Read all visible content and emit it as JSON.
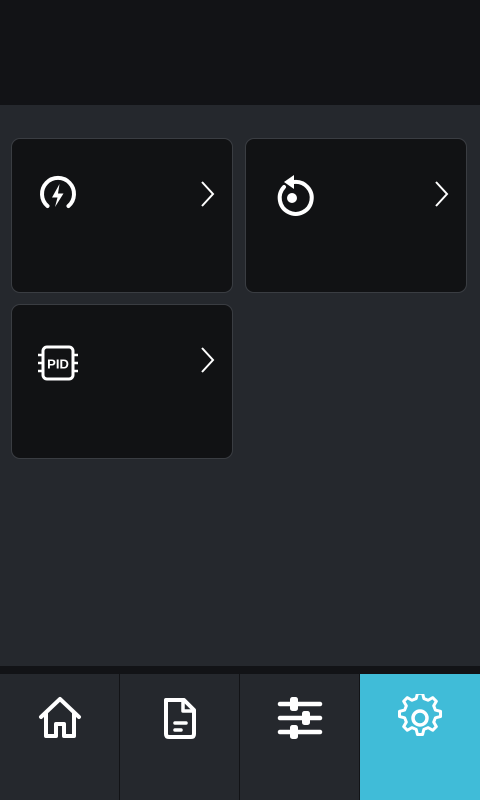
{
  "colors": {
    "background": "#25282d",
    "top_bar": "#121316",
    "card": "#111214",
    "card_border": "#3a3d42",
    "active_tab": "#40bcd8",
    "icon": "#ffffff"
  },
  "cards": [
    {
      "icon": "power-bolt-icon",
      "label": ""
    },
    {
      "icon": "restart-icon",
      "label": ""
    },
    {
      "icon": "pid-chip-icon",
      "label": ""
    }
  ],
  "nav": {
    "tabs": [
      {
        "icon": "home-icon",
        "active": false
      },
      {
        "icon": "document-icon",
        "active": false
      },
      {
        "icon": "sliders-icon",
        "active": false
      },
      {
        "icon": "gear-icon",
        "active": true
      }
    ]
  }
}
